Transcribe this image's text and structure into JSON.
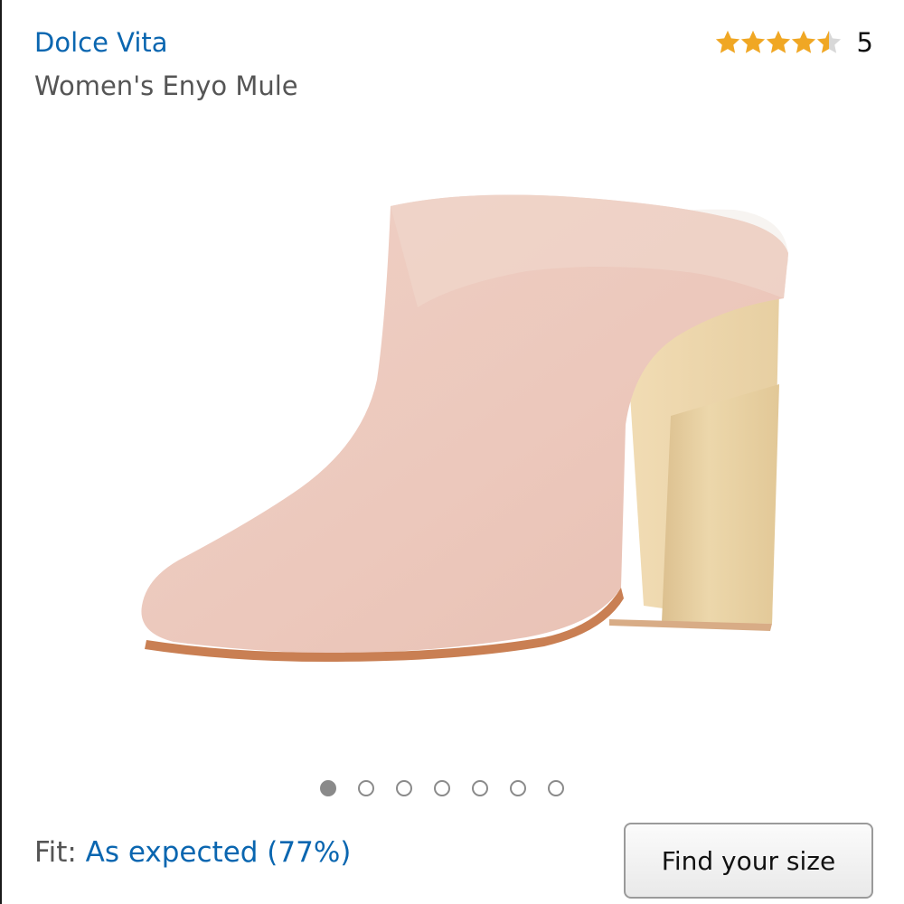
{
  "product": {
    "brand": "Dolce Vita",
    "title": "Women's Enyo Mule"
  },
  "rating": {
    "stars": 4.5,
    "count": "5",
    "star_color": "#f0a724"
  },
  "carousel": {
    "total": 7,
    "active_index": 0
  },
  "fit": {
    "label": "Fit: ",
    "value": "As expected (77%)"
  },
  "buttons": {
    "find_size": "Find your size"
  },
  "colors": {
    "link": "#0a66b0",
    "muted_text": "#555555"
  }
}
